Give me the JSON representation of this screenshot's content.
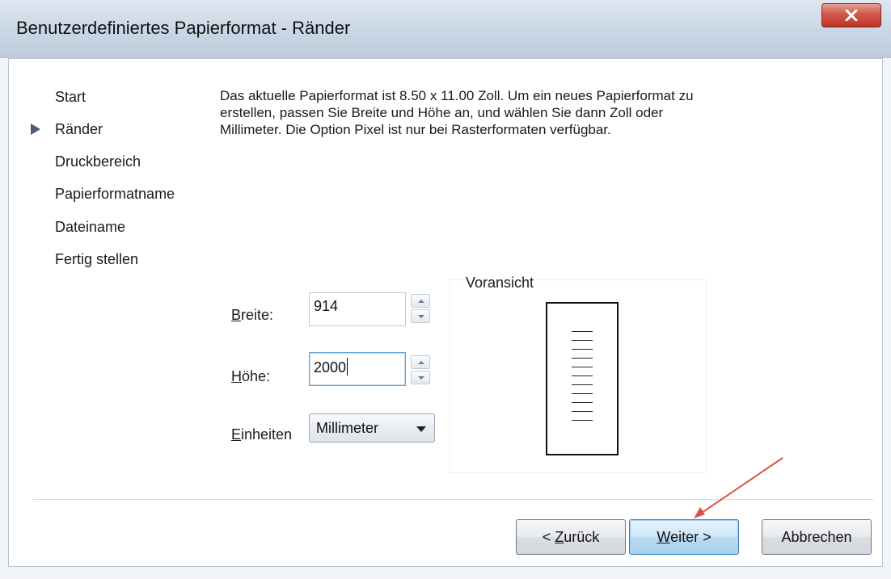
{
  "window": {
    "title": "Benutzerdefiniertes Papierformat - Ränder",
    "close_icon": "close-x-icon"
  },
  "steps": [
    {
      "label": "Start"
    },
    {
      "label": "Ränder",
      "current": true
    },
    {
      "label": "Druckbereich"
    },
    {
      "label": "Papierformatname"
    },
    {
      "label": "Dateiname"
    },
    {
      "label": "Fertig stellen"
    }
  ],
  "description": "Das aktuelle Papierformat ist 8.50 x 11.00 Zoll. Um ein neues Papierformat zu erstellen, passen Sie Breite und Höhe an, und wählen Sie dann Zoll oder Millimeter. Die Option Pixel ist nur bei Rasterformaten verfügbar.",
  "form": {
    "width": {
      "label_mnemonic": "B",
      "label_rest": "reite:",
      "value": "914"
    },
    "height": {
      "label_mnemonic": "H",
      "label_rest": "öhe:",
      "value": "2000"
    },
    "units": {
      "label_mnemonic": "E",
      "label_rest": "inheiten",
      "selected": "Millimeter"
    }
  },
  "preview": {
    "title": "Voransicht",
    "line_count": 11
  },
  "buttons": {
    "back": {
      "pre": "< ",
      "mnemonic": "Z",
      "rest": "urück"
    },
    "next": {
      "mnemonic": "W",
      "rest": "eiter >"
    },
    "cancel": {
      "label": "Abbrechen"
    }
  },
  "colors": {
    "annotation_arrow": "#e0504a",
    "default_button_border": "#3b7fb8"
  }
}
